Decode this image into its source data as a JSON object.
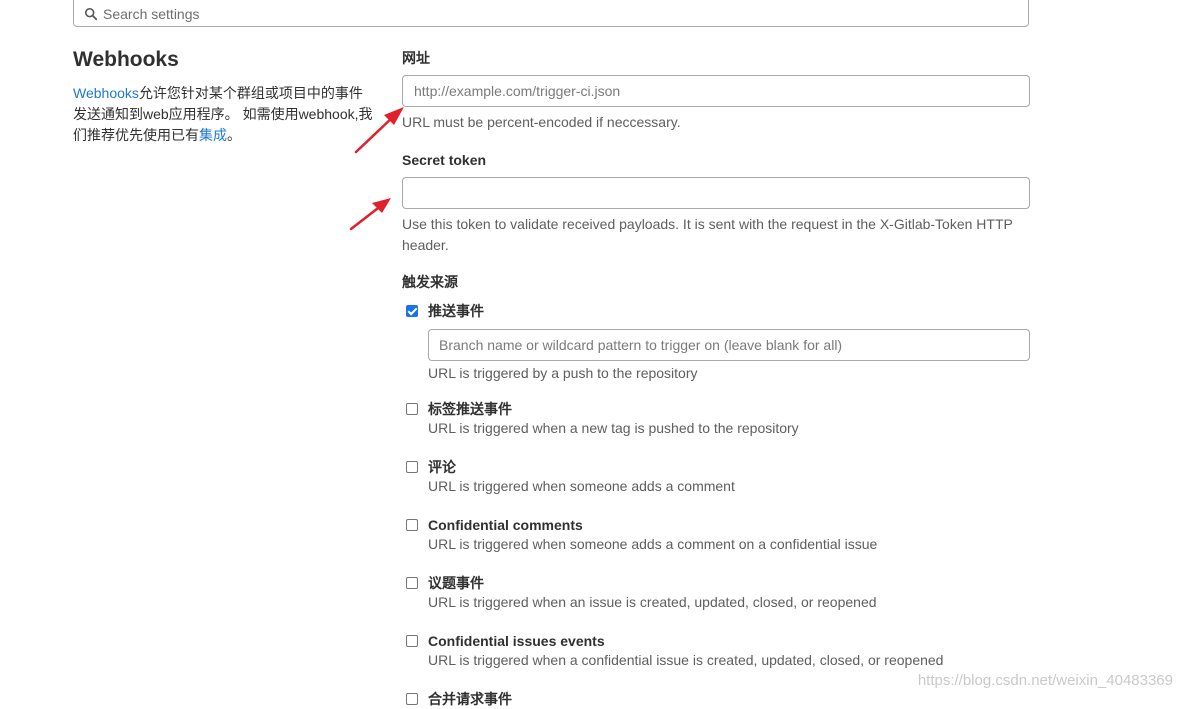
{
  "search": {
    "placeholder": "Search settings"
  },
  "section": {
    "title": "Webhooks",
    "desc_link": "Webhooks",
    "desc_part1": "允许您针对某个群组或项目中的事件发送通知到web应用程序。 如需使用webhook,我们推荐优先使用已有",
    "desc_link2": "集成",
    "desc_end": "。"
  },
  "url_field": {
    "label": "网址",
    "placeholder": "http://example.com/trigger-ci.json",
    "value": "",
    "help": "URL must be percent-encoded if neccessary."
  },
  "token_field": {
    "label": "Secret token",
    "value": "",
    "help": "Use this token to validate received payloads. It is sent with the request in the X-Gitlab-Token HTTP header."
  },
  "triggers": {
    "label": "触发来源",
    "items": [
      {
        "label": "推送事件",
        "checked": true,
        "branch_placeholder": "Branch name or wildcard pattern to trigger on (leave blank for all)",
        "help": "URL is triggered by a push to the repository"
      },
      {
        "label": "标签推送事件",
        "checked": false,
        "help": "URL is triggered when a new tag is pushed to the repository"
      },
      {
        "label": "评论",
        "checked": false,
        "help": "URL is triggered when someone adds a comment"
      },
      {
        "label": "Confidential comments",
        "checked": false,
        "help": "URL is triggered when someone adds a comment on a confidential issue"
      },
      {
        "label": "议题事件",
        "checked": false,
        "help": "URL is triggered when an issue is created, updated, closed, or reopened"
      },
      {
        "label": "Confidential issues events",
        "checked": false,
        "help": "URL is triggered when a confidential issue is created, updated, closed, or reopened"
      },
      {
        "label": "合并请求事件",
        "checked": false,
        "help": ""
      }
    ]
  },
  "watermark": "https://blog.csdn.net/weixin_40483369",
  "colors": {
    "link": "#1f78d1",
    "checkbox_checked": "#1a73e8",
    "arrow": "#e0202a"
  }
}
